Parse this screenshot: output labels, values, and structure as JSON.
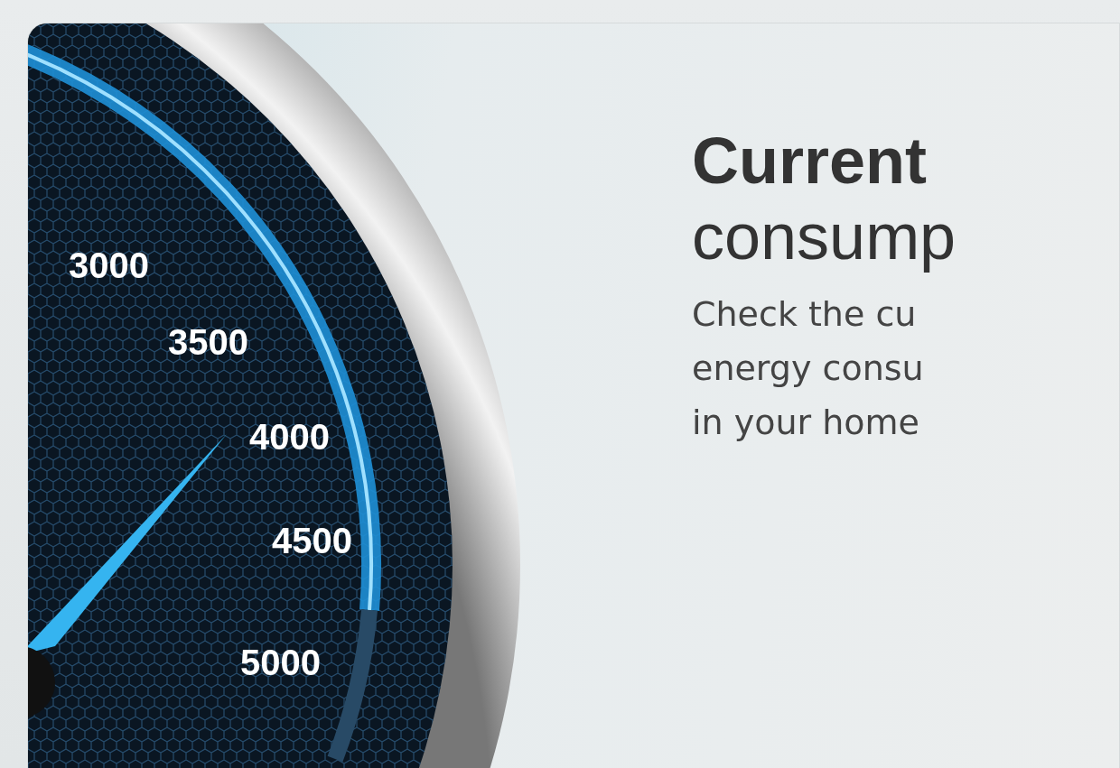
{
  "gauge": {
    "labels": [
      "3000",
      "3500",
      "4000",
      "4500",
      "5000"
    ]
  },
  "heading": {
    "bold": "Current",
    "light": "consump"
  },
  "description": {
    "lines": [
      "Check the cu",
      "energy consu",
      "in your home"
    ]
  }
}
